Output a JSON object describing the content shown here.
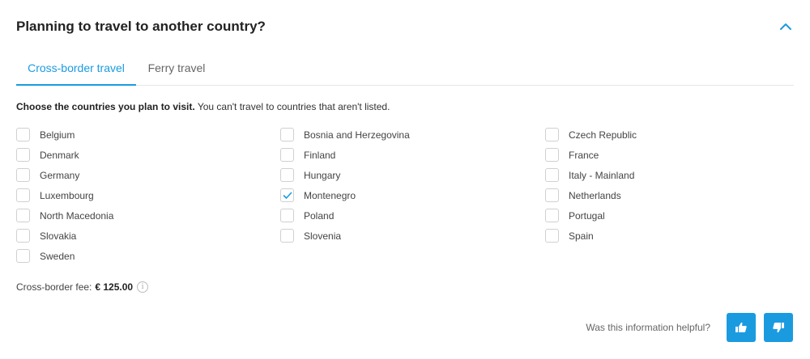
{
  "header": {
    "title": "Planning to travel to another country?",
    "collapse_icon": "chevron-up-icon",
    "accent_color": "#1a9be0"
  },
  "tabs": [
    {
      "label": "Cross-border travel",
      "active": true
    },
    {
      "label": "Ferry travel",
      "active": false
    }
  ],
  "instruction": {
    "bold": "Choose the countries you plan to visit.",
    "text": " You can't travel to countries that aren't listed."
  },
  "countries": {
    "col1": [
      {
        "label": "Belgium",
        "checked": false
      },
      {
        "label": "Denmark",
        "checked": false
      },
      {
        "label": "Germany",
        "checked": false
      },
      {
        "label": "Luxembourg",
        "checked": false
      },
      {
        "label": "North Macedonia",
        "checked": false
      },
      {
        "label": "Slovakia",
        "checked": false
      },
      {
        "label": "Sweden",
        "checked": false
      }
    ],
    "col2": [
      {
        "label": "Bosnia and Herzegovina",
        "checked": false
      },
      {
        "label": "Finland",
        "checked": false
      },
      {
        "label": "Hungary",
        "checked": false
      },
      {
        "label": "Montenegro",
        "checked": true
      },
      {
        "label": "Poland",
        "checked": false
      },
      {
        "label": "Slovenia",
        "checked": false
      }
    ],
    "col3": [
      {
        "label": "Czech Republic",
        "checked": false
      },
      {
        "label": "France",
        "checked": false
      },
      {
        "label": "Italy - Mainland",
        "checked": false
      },
      {
        "label": "Netherlands",
        "checked": false
      },
      {
        "label": "Portugal",
        "checked": false
      },
      {
        "label": "Spain",
        "checked": false
      }
    ]
  },
  "fee": {
    "label": "Cross-border fee:",
    "value": "€ 125.00",
    "info_icon": "info-icon",
    "info_glyph": "i"
  },
  "feedback": {
    "question": "Was this information helpful?",
    "up_icon": "thumbs-up-icon",
    "down_icon": "thumbs-down-icon"
  }
}
